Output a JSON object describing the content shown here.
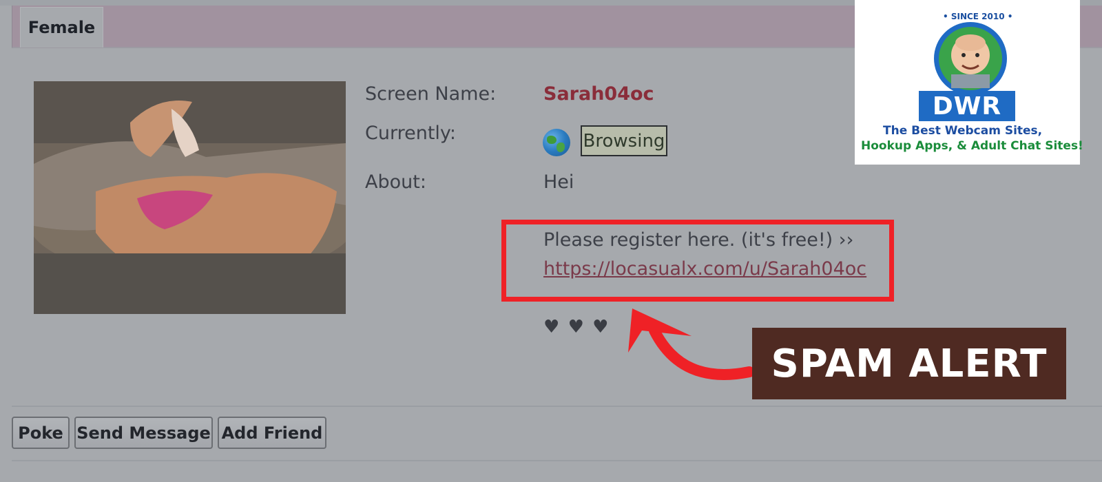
{
  "profile": {
    "tab_label": "Female",
    "fields": {
      "screen_name_label": "Screen Name:",
      "screen_name_value": "Sarah04oc",
      "currently_label": "Currently:",
      "status_value": "Browsing",
      "about_label": "About:",
      "about_value": "Hei",
      "register_text": "Please register here. (it's free!) ››",
      "register_link": "https://locasualx.com/u/Sarah04oc",
      "hearts": "♥ ♥ ♥"
    },
    "actions": {
      "poke": "Poke",
      "send_message": "Send Message",
      "add_friend": "Add Friend"
    }
  },
  "overlay": {
    "spam_alert": "SPAM ALERT",
    "highlight_color": "#ef2126",
    "banner_color": "#4f2a22"
  },
  "logo": {
    "since": "• SINCE 2010 •",
    "brand": "DWR",
    "tagline_1": "The Best Webcam Sites,",
    "tagline_2": "Hookup Apps, & Adult Chat Sites!"
  },
  "icons": {
    "status_icon": "globe-icon",
    "arrow": "curved-arrow-icon"
  }
}
